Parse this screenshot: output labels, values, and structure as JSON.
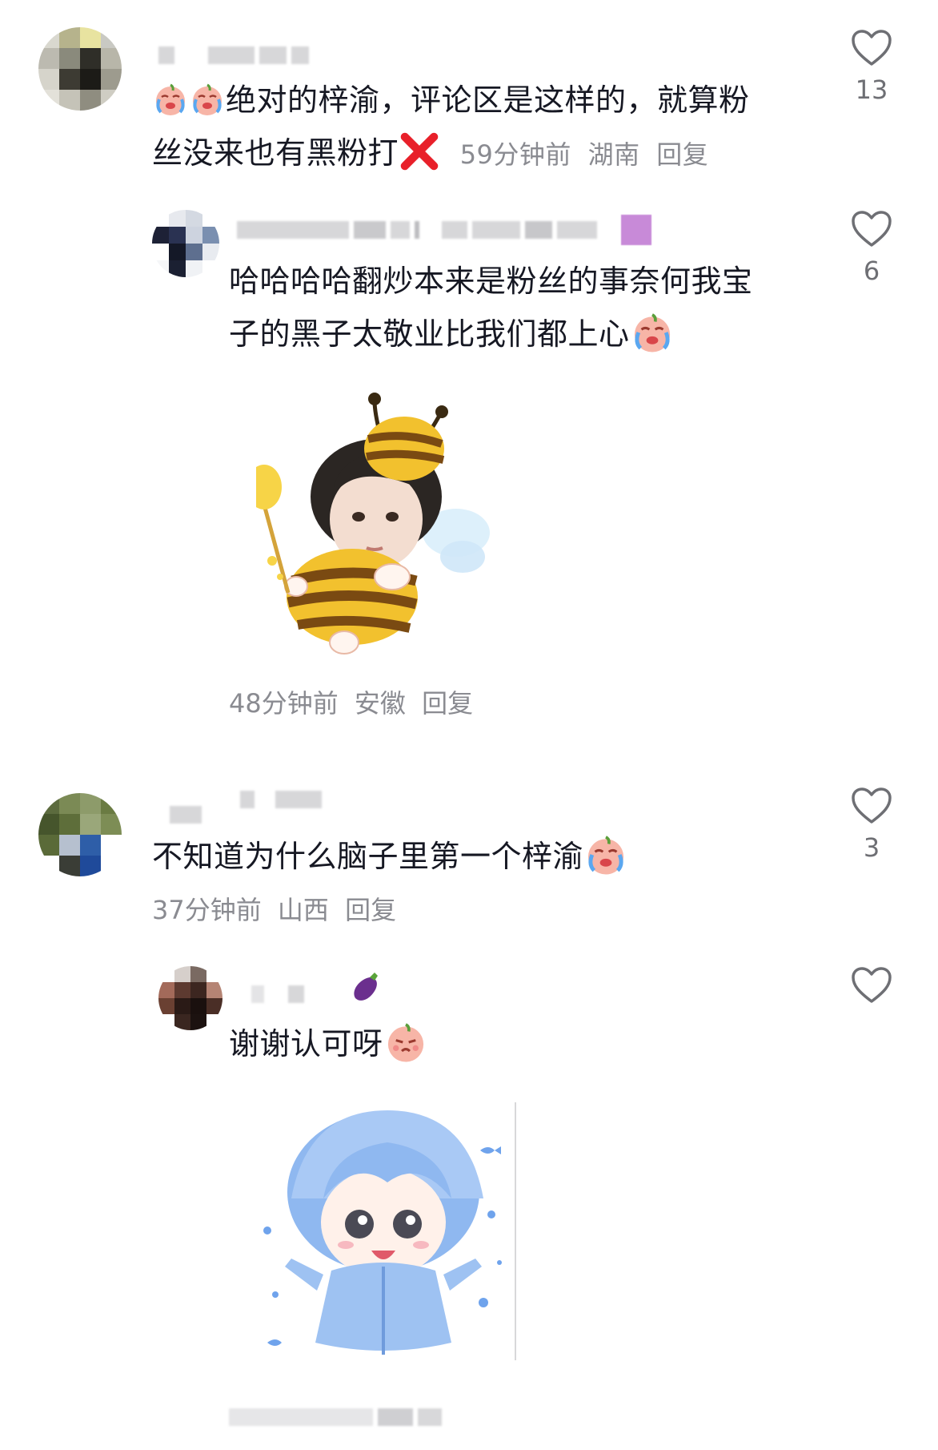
{
  "comments": [
    {
      "text_a": "绝对的梓渝，评论区是这样的，就算粉",
      "text_b": "丝没来也有黑粉打",
      "time": "59分钟前",
      "location": "湖南",
      "reply_label": "回复",
      "likes": "13"
    },
    {
      "text_a": "哈哈哈哈翻炒本来是粉丝的事奈何我宝",
      "text_b": "子的黑子太敬业比我们都上心",
      "time": "48分钟前",
      "location": "安徽",
      "reply_label": "回复",
      "likes": "6"
    },
    {
      "text_a": "不知道为什么脑子里第一个梓渝",
      "time": "37分钟前",
      "location": "山西",
      "reply_label": "回复",
      "likes": "3"
    },
    {
      "text_a": "谢谢认可呀",
      "likes": ""
    }
  ],
  "colors": {
    "text": "#161823",
    "meta": "#8a8b91",
    "heart_stroke": "#6e6f74",
    "cross": "#e8202a",
    "bee_yellow": "#f2c12e",
    "bee_brown": "#7a4a12",
    "chibi_blue": "#8fb8f0"
  },
  "icons": {
    "like": "heart-outline-icon",
    "emoji_cry": "crying-face-emoji",
    "emoji_cross": "red-cross-emoji",
    "emoji_eggplant": "eggplant-emoji",
    "emoji_pout": "pouting-face-emoji"
  }
}
